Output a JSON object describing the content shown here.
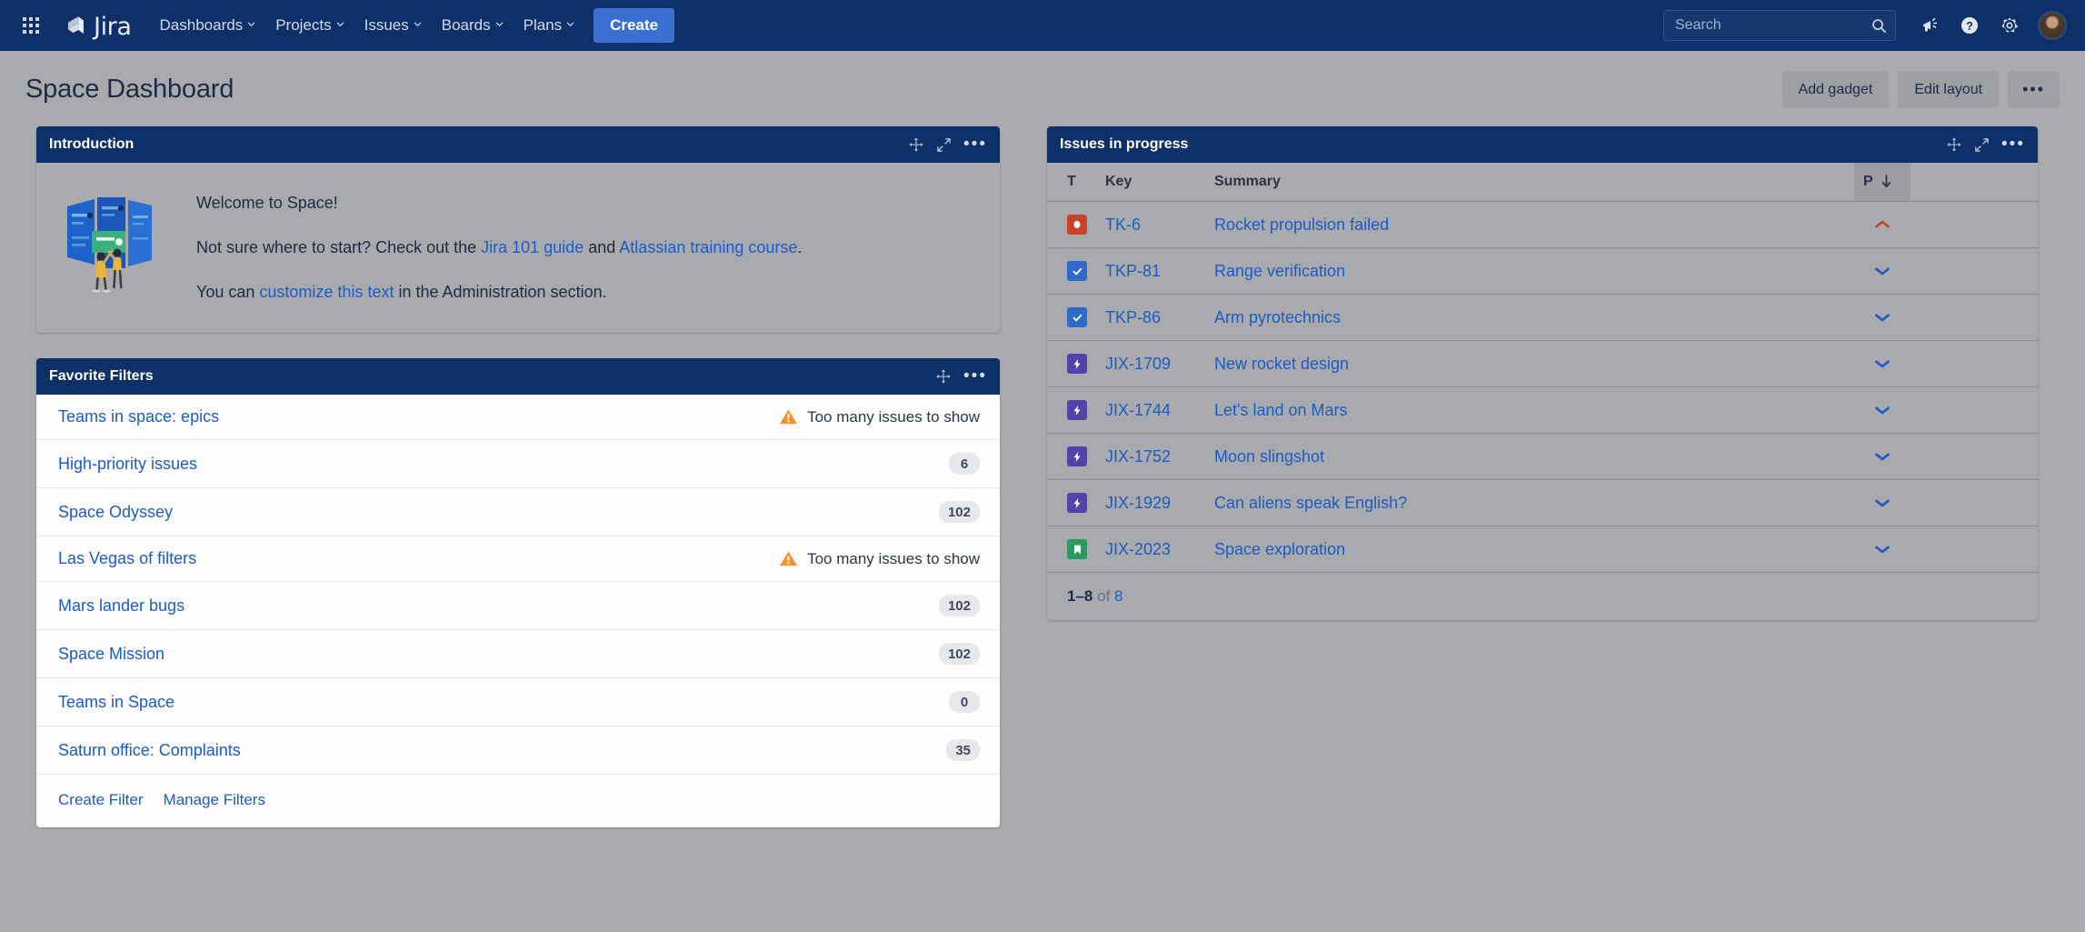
{
  "colors": {
    "nav_bg": "#0d3069",
    "page_bg": "#a9aaad",
    "accent_blue": "#1d5bc4",
    "create_btn": "#3b6fd4",
    "bug_red": "#c94228",
    "task_blue": "#2f69c9",
    "epic_purple": "#5243aa",
    "story_green": "#289b5e",
    "warn_orange": "#f5912a",
    "priority_high": "#c0462a",
    "priority_low": "#1d5bc4"
  },
  "nav": {
    "app_switcher_icon": "grid-apps-icon",
    "logo_icon": "jira-logo-icon",
    "logo_text": "Jira",
    "items": [
      {
        "label": "Dashboards",
        "icon": "chevron-down-icon"
      },
      {
        "label": "Projects",
        "icon": "chevron-down-icon"
      },
      {
        "label": "Issues",
        "icon": "chevron-down-icon"
      },
      {
        "label": "Boards",
        "icon": "chevron-down-icon"
      },
      {
        "label": "Plans",
        "icon": "chevron-down-icon"
      }
    ],
    "create_label": "Create",
    "search": {
      "value": "",
      "placeholder": "Search",
      "icon": "search-icon"
    },
    "right_icons": [
      {
        "name": "announcements-megaphone-icon"
      },
      {
        "name": "help-question-icon"
      },
      {
        "name": "settings-gear-icon"
      },
      {
        "name": "user-avatar"
      }
    ]
  },
  "header": {
    "title": "Space Dashboard",
    "add_gadget_label": "Add gadget",
    "edit_layout_label": "Edit layout",
    "more_label": "•••"
  },
  "gadget_tools": {
    "move_icon": "move-drag-icon",
    "maximize_icon": "maximize-expand-icon",
    "more_icon": "more-options-icon",
    "more_label": "•••"
  },
  "introduction": {
    "title": "Introduction",
    "illustration_icon": "welcome-illustration",
    "line1": "Welcome to Space!",
    "line2_pre": "Not sure where to start? Check out the ",
    "link_jira101": "Jira 101 guide",
    "line2_mid": " and ",
    "link_training": "Atlassian training course",
    "line2_post": ".",
    "line3_pre": "You can ",
    "link_customize": "customize this text",
    "line3_post": " in the Administration section."
  },
  "favorite_filters": {
    "title": "Favorite Filters",
    "warning_icon": "warning-triangle-icon",
    "rows": [
      {
        "name": "Teams in space: epics",
        "count": null,
        "warning": "Too many issues to show"
      },
      {
        "name": "High-priority issues",
        "count": "6",
        "warning": null
      },
      {
        "name": "Space Odyssey",
        "count": "102",
        "warning": null
      },
      {
        "name": "Las Vegas of filters",
        "count": null,
        "warning": "Too many issues to show"
      },
      {
        "name": "Mars lander bugs",
        "count": "102",
        "warning": null
      },
      {
        "name": "Space Mission",
        "count": "102",
        "warning": null
      },
      {
        "name": "Teams in Space",
        "count": "0",
        "warning": null
      },
      {
        "name": "Saturn office: Complaints",
        "count": "35",
        "warning": null
      }
    ],
    "create_filter_label": "Create Filter",
    "manage_filters_label": "Manage Filters"
  },
  "issues_in_progress": {
    "title": "Issues in progress",
    "columns": {
      "type": "T",
      "key": "Key",
      "summary": "Summary",
      "priority": "P",
      "sort_icon": "sort-descending-arrow-icon"
    },
    "rows": [
      {
        "type_icon": "bug-icon",
        "type_class": "ti-bug",
        "key": "TK-6",
        "summary": "Rocket propulsion failed",
        "priority_icon": "priority-high-icon",
        "priority": "high"
      },
      {
        "type_icon": "task-icon",
        "type_class": "ti-task",
        "key": "TKP-81",
        "summary": "Range verification",
        "priority_icon": "priority-low-icon",
        "priority": "low"
      },
      {
        "type_icon": "task-icon",
        "type_class": "ti-task",
        "key": "TKP-86",
        "summary": "Arm pyrotechnics",
        "priority_icon": "priority-low-icon",
        "priority": "low"
      },
      {
        "type_icon": "epic-icon",
        "type_class": "ti-epic",
        "key": "JIX-1709",
        "summary": "New rocket design",
        "priority_icon": "priority-low-icon",
        "priority": "low"
      },
      {
        "type_icon": "epic-icon",
        "type_class": "ti-epic",
        "key": "JIX-1744",
        "summary": "Let's land on Mars",
        "priority_icon": "priority-low-icon",
        "priority": "low"
      },
      {
        "type_icon": "epic-icon",
        "type_class": "ti-epic",
        "key": "JIX-1752",
        "summary": "Moon slingshot",
        "priority_icon": "priority-low-icon",
        "priority": "low"
      },
      {
        "type_icon": "epic-icon",
        "type_class": "ti-epic",
        "key": "JIX-1929",
        "summary": "Can aliens speak English?",
        "priority_icon": "priority-low-icon",
        "priority": "low"
      },
      {
        "type_icon": "story-icon",
        "type_class": "ti-story",
        "key": "JIX-2023",
        "summary": "Space exploration",
        "priority_icon": "priority-low-icon",
        "priority": "low"
      }
    ],
    "footer": {
      "range": "1–8",
      "of": "of",
      "total": "8"
    }
  }
}
